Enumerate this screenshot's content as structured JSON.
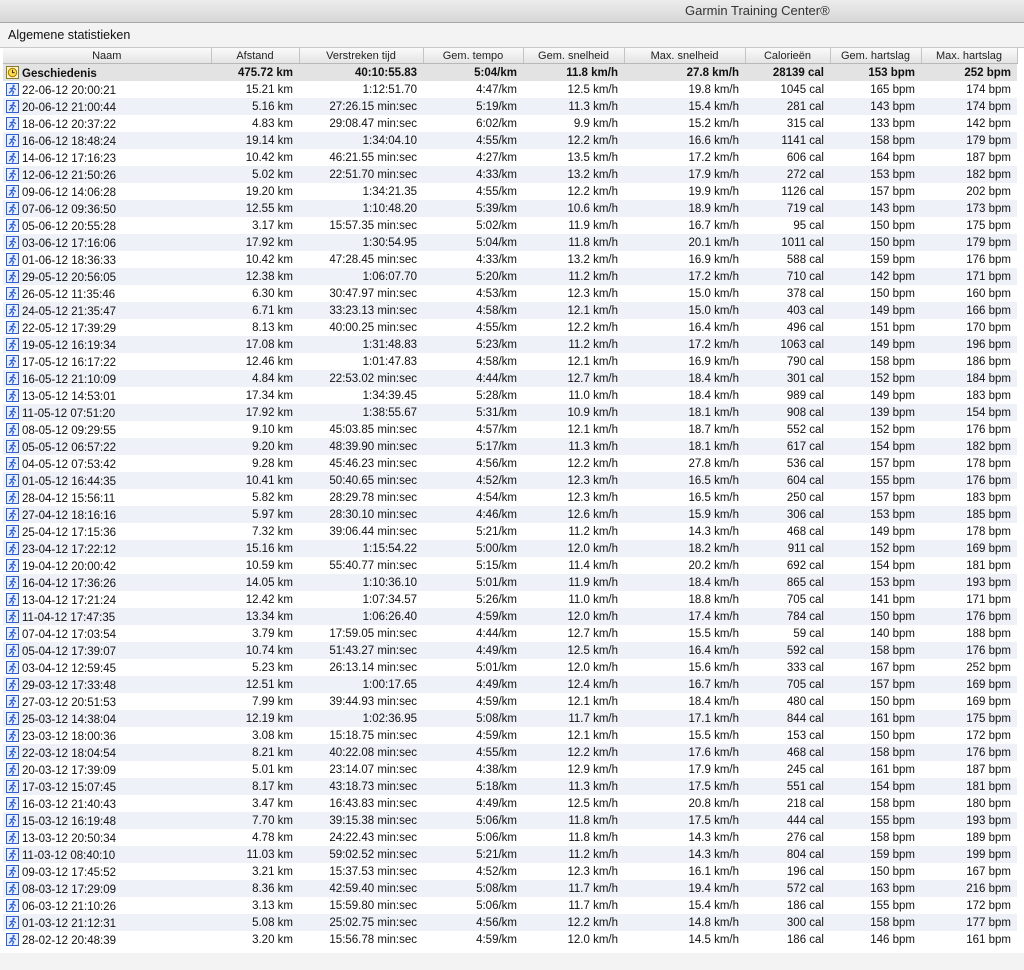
{
  "app": {
    "title": "Garmin Training Center®"
  },
  "section": {
    "title": "Algemene statistieken"
  },
  "columns": [
    "Naam",
    "Afstand",
    "Verstreken tijd",
    "Gem. tempo",
    "Gem. snelheid",
    "Max. snelheid",
    "Calorieën",
    "Gem. hartslag",
    "Max. hartslag"
  ],
  "icons": {
    "summary": "history-clock-icon",
    "activity": "running-icon"
  },
  "colors": {
    "activity_icon": "#2f5fd0",
    "summary_icon": "#d8a400"
  },
  "summary": [
    "Geschiedenis",
    "475.72 km",
    "40:10:55.83",
    "5:04/km",
    "11.8 km/h",
    "27.8 km/h",
    "28139 cal",
    "153 bpm",
    "252 bpm"
  ],
  "rows": [
    [
      "22-06-12 20:00:21",
      "15.21 km",
      "1:12:51.70",
      "4:47/km",
      "12.5 km/h",
      "19.8 km/h",
      "1045 cal",
      "165 bpm",
      "174 bpm"
    ],
    [
      "20-06-12 21:00:44",
      "5.16 km",
      "27:26.15 min:sec",
      "5:19/km",
      "11.3 km/h",
      "15.4 km/h",
      "281 cal",
      "143 bpm",
      "174 bpm"
    ],
    [
      "18-06-12 20:37:22",
      "4.83 km",
      "29:08.47 min:sec",
      "6:02/km",
      "9.9 km/h",
      "15.2 km/h",
      "315 cal",
      "133 bpm",
      "142 bpm"
    ],
    [
      "16-06-12 18:48:24",
      "19.14 km",
      "1:34:04.10",
      "4:55/km",
      "12.2 km/h",
      "16.6 km/h",
      "1141 cal",
      "158 bpm",
      "179 bpm"
    ],
    [
      "14-06-12 17:16:23",
      "10.42 km",
      "46:21.55 min:sec",
      "4:27/km",
      "13.5 km/h",
      "17.2 km/h",
      "606 cal",
      "164 bpm",
      "187 bpm"
    ],
    [
      "12-06-12 21:50:26",
      "5.02 km",
      "22:51.70 min:sec",
      "4:33/km",
      "13.2 km/h",
      "17.9 km/h",
      "272 cal",
      "153 bpm",
      "182 bpm"
    ],
    [
      "09-06-12 14:06:28",
      "19.20 km",
      "1:34:21.35",
      "4:55/km",
      "12.2 km/h",
      "19.9 km/h",
      "1126 cal",
      "157 bpm",
      "202 bpm"
    ],
    [
      "07-06-12 09:36:50",
      "12.55 km",
      "1:10:48.20",
      "5:39/km",
      "10.6 km/h",
      "18.9 km/h",
      "719 cal",
      "143 bpm",
      "173 bpm"
    ],
    [
      "05-06-12 20:55:28",
      "3.17 km",
      "15:57.35 min:sec",
      "5:02/km",
      "11.9 km/h",
      "16.7 km/h",
      "95 cal",
      "150 bpm",
      "175 bpm"
    ],
    [
      "03-06-12 17:16:06",
      "17.92 km",
      "1:30:54.95",
      "5:04/km",
      "11.8 km/h",
      "20.1 km/h",
      "1011 cal",
      "150 bpm",
      "179 bpm"
    ],
    [
      "01-06-12 18:36:33",
      "10.42 km",
      "47:28.45 min:sec",
      "4:33/km",
      "13.2 km/h",
      "16.9 km/h",
      "588 cal",
      "159 bpm",
      "176 bpm"
    ],
    [
      "29-05-12 20:56:05",
      "12.38 km",
      "1:06:07.70",
      "5:20/km",
      "11.2 km/h",
      "17.2 km/h",
      "710 cal",
      "142 bpm",
      "171 bpm"
    ],
    [
      "26-05-12 11:35:46",
      "6.30 km",
      "30:47.97 min:sec",
      "4:53/km",
      "12.3 km/h",
      "15.0 km/h",
      "378 cal",
      "150 bpm",
      "160 bpm"
    ],
    [
      "24-05-12 21:35:47",
      "6.71 km",
      "33:23.13 min:sec",
      "4:58/km",
      "12.1 km/h",
      "15.0 km/h",
      "403 cal",
      "149 bpm",
      "166 bpm"
    ],
    [
      "22-05-12 17:39:29",
      "8.13 km",
      "40:00.25 min:sec",
      "4:55/km",
      "12.2 km/h",
      "16.4 km/h",
      "496 cal",
      "151 bpm",
      "170 bpm"
    ],
    [
      "19-05-12 16:19:34",
      "17.08 km",
      "1:31:48.83",
      "5:23/km",
      "11.2 km/h",
      "17.2 km/h",
      "1063 cal",
      "149 bpm",
      "196 bpm"
    ],
    [
      "17-05-12 16:17:22",
      "12.46 km",
      "1:01:47.83",
      "4:58/km",
      "12.1 km/h",
      "16.9 km/h",
      "790 cal",
      "158 bpm",
      "186 bpm"
    ],
    [
      "16-05-12 21:10:09",
      "4.84 km",
      "22:53.02 min:sec",
      "4:44/km",
      "12.7 km/h",
      "18.4 km/h",
      "301 cal",
      "152 bpm",
      "184 bpm"
    ],
    [
      "13-05-12 14:53:01",
      "17.34 km",
      "1:34:39.45",
      "5:28/km",
      "11.0 km/h",
      "18.4 km/h",
      "989 cal",
      "149 bpm",
      "183 bpm"
    ],
    [
      "11-05-12 07:51:20",
      "17.92 km",
      "1:38:55.67",
      "5:31/km",
      "10.9 km/h",
      "18.1 km/h",
      "908 cal",
      "139 bpm",
      "154 bpm"
    ],
    [
      "08-05-12 09:29:55",
      "9.10 km",
      "45:03.85 min:sec",
      "4:57/km",
      "12.1 km/h",
      "18.7 km/h",
      "552 cal",
      "152 bpm",
      "176 bpm"
    ],
    [
      "05-05-12 06:57:22",
      "9.20 km",
      "48:39.90 min:sec",
      "5:17/km",
      "11.3 km/h",
      "18.1 km/h",
      "617 cal",
      "154 bpm",
      "182 bpm"
    ],
    [
      "04-05-12 07:53:42",
      "9.28 km",
      "45:46.23 min:sec",
      "4:56/km",
      "12.2 km/h",
      "27.8 km/h",
      "536 cal",
      "157 bpm",
      "178 bpm"
    ],
    [
      "01-05-12 16:44:35",
      "10.41 km",
      "50:40.65 min:sec",
      "4:52/km",
      "12.3 km/h",
      "16.5 km/h",
      "604 cal",
      "155 bpm",
      "176 bpm"
    ],
    [
      "28-04-12 15:56:11",
      "5.82 km",
      "28:29.78 min:sec",
      "4:54/km",
      "12.3 km/h",
      "16.5 km/h",
      "250 cal",
      "157 bpm",
      "183 bpm"
    ],
    [
      "27-04-12 18:16:16",
      "5.97 km",
      "28:30.10 min:sec",
      "4:46/km",
      "12.6 km/h",
      "15.9 km/h",
      "306 cal",
      "153 bpm",
      "185 bpm"
    ],
    [
      "25-04-12 17:15:36",
      "7.32 km",
      "39:06.44 min:sec",
      "5:21/km",
      "11.2 km/h",
      "14.3 km/h",
      "468 cal",
      "149 bpm",
      "178 bpm"
    ],
    [
      "23-04-12 17:22:12",
      "15.16 km",
      "1:15:54.22",
      "5:00/km",
      "12.0 km/h",
      "18.2 km/h",
      "911 cal",
      "152 bpm",
      "169 bpm"
    ],
    [
      "19-04-12 20:00:42",
      "10.59 km",
      "55:40.77 min:sec",
      "5:15/km",
      "11.4 km/h",
      "20.2 km/h",
      "692 cal",
      "154 bpm",
      "181 bpm"
    ],
    [
      "16-04-12 17:36:26",
      "14.05 km",
      "1:10:36.10",
      "5:01/km",
      "11.9 km/h",
      "18.4 km/h",
      "865 cal",
      "153 bpm",
      "193 bpm"
    ],
    [
      "13-04-12 17:21:24",
      "12.42 km",
      "1:07:34.57",
      "5:26/km",
      "11.0 km/h",
      "18.8 km/h",
      "705 cal",
      "141 bpm",
      "171 bpm"
    ],
    [
      "11-04-12 17:47:35",
      "13.34 km",
      "1:06:26.40",
      "4:59/km",
      "12.0 km/h",
      "17.4 km/h",
      "784 cal",
      "150 bpm",
      "176 bpm"
    ],
    [
      "07-04-12 17:03:54",
      "3.79 km",
      "17:59.05 min:sec",
      "4:44/km",
      "12.7 km/h",
      "15.5 km/h",
      "59 cal",
      "140 bpm",
      "188 bpm"
    ],
    [
      "05-04-12 17:39:07",
      "10.74 km",
      "51:43.27 min:sec",
      "4:49/km",
      "12.5 km/h",
      "16.4 km/h",
      "592 cal",
      "158 bpm",
      "176 bpm"
    ],
    [
      "03-04-12 12:59:45",
      "5.23 km",
      "26:13.14 min:sec",
      "5:01/km",
      "12.0 km/h",
      "15.6 km/h",
      "333 cal",
      "167 bpm",
      "252 bpm"
    ],
    [
      "29-03-12 17:33:48",
      "12.51 km",
      "1:00:17.65",
      "4:49/km",
      "12.4 km/h",
      "16.7 km/h",
      "705 cal",
      "157 bpm",
      "169 bpm"
    ],
    [
      "27-03-12 20:51:53",
      "7.99 km",
      "39:44.93 min:sec",
      "4:59/km",
      "12.1 km/h",
      "18.4 km/h",
      "480 cal",
      "150 bpm",
      "169 bpm"
    ],
    [
      "25-03-12 14:38:04",
      "12.19 km",
      "1:02:36.95",
      "5:08/km",
      "11.7 km/h",
      "17.1 km/h",
      "844 cal",
      "161 bpm",
      "175 bpm"
    ],
    [
      "23-03-12 18:00:36",
      "3.08 km",
      "15:18.75 min:sec",
      "4:59/km",
      "12.1 km/h",
      "15.5 km/h",
      "153 cal",
      "150 bpm",
      "172 bpm"
    ],
    [
      "22-03-12 18:04:54",
      "8.21 km",
      "40:22.08 min:sec",
      "4:55/km",
      "12.2 km/h",
      "17.6 km/h",
      "468 cal",
      "158 bpm",
      "176 bpm"
    ],
    [
      "20-03-12 17:39:09",
      "5.01 km",
      "23:14.07 min:sec",
      "4:38/km",
      "12.9 km/h",
      "17.9 km/h",
      "245 cal",
      "161 bpm",
      "187 bpm"
    ],
    [
      "17-03-12 15:07:45",
      "8.17 km",
      "43:18.73 min:sec",
      "5:18/km",
      "11.3 km/h",
      "17.5 km/h",
      "551 cal",
      "154 bpm",
      "181 bpm"
    ],
    [
      "16-03-12 21:40:43",
      "3.47 km",
      "16:43.83 min:sec",
      "4:49/km",
      "12.5 km/h",
      "20.8 km/h",
      "218 cal",
      "158 bpm",
      "180 bpm"
    ],
    [
      "15-03-12 16:19:48",
      "7.70 km",
      "39:15.38 min:sec",
      "5:06/km",
      "11.8 km/h",
      "17.5 km/h",
      "444 cal",
      "155 bpm",
      "193 bpm"
    ],
    [
      "13-03-12 20:50:34",
      "4.78 km",
      "24:22.43 min:sec",
      "5:06/km",
      "11.8 km/h",
      "14.3 km/h",
      "276 cal",
      "158 bpm",
      "189 bpm"
    ],
    [
      "11-03-12 08:40:10",
      "11.03 km",
      "59:02.52 min:sec",
      "5:21/km",
      "11.2 km/h",
      "14.3 km/h",
      "804 cal",
      "159 bpm",
      "199 bpm"
    ],
    [
      "09-03-12 17:45:52",
      "3.21 km",
      "15:37.53 min:sec",
      "4:52/km",
      "12.3 km/h",
      "16.1 km/h",
      "196 cal",
      "150 bpm",
      "167 bpm"
    ],
    [
      "08-03-12 17:29:09",
      "8.36 km",
      "42:59.40 min:sec",
      "5:08/km",
      "11.7 km/h",
      "19.4 km/h",
      "572 cal",
      "163 bpm",
      "216 bpm"
    ],
    [
      "06-03-12 21:10:26",
      "3.13 km",
      "15:59.80 min:sec",
      "5:06/km",
      "11.7 km/h",
      "15.4 km/h",
      "186 cal",
      "155 bpm",
      "172 bpm"
    ],
    [
      "01-03-12 21:12:31",
      "5.08 km",
      "25:02.75 min:sec",
      "4:56/km",
      "12.2 km/h",
      "14.8 km/h",
      "300 cal",
      "158 bpm",
      "177 bpm"
    ],
    [
      "28-02-12 20:48:39",
      "3.20 km",
      "15:56.78 min:sec",
      "4:59/km",
      "12.0 km/h",
      "14.5 km/h",
      "186 cal",
      "146 bpm",
      "161 bpm"
    ]
  ]
}
